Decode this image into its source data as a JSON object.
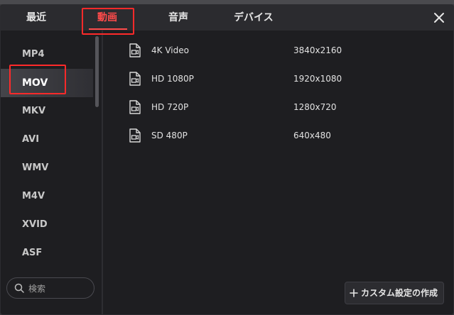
{
  "tabs": [
    {
      "label": "最近",
      "active": false
    },
    {
      "label": "動画",
      "active": true
    },
    {
      "label": "音声",
      "active": false
    },
    {
      "label": "デバイス",
      "active": false
    }
  ],
  "formats": [
    "MP4",
    "MOV",
    "MKV",
    "AVI",
    "WMV",
    "M4V",
    "XVID",
    "ASF"
  ],
  "selected_format": "MOV",
  "presets": [
    {
      "name": "4K Video",
      "resolution": "3840x2160"
    },
    {
      "name": "HD 1080P",
      "resolution": "1920x1080"
    },
    {
      "name": "HD 720P",
      "resolution": "1280x720"
    },
    {
      "name": "SD 480P",
      "resolution": "640x480"
    }
  ],
  "search": {
    "placeholder": "検索"
  },
  "custom_button": {
    "label": "カスタム設定の作成"
  },
  "colors": {
    "accent": "#ff4b4b",
    "background": "#1e1e21",
    "tabbar": "#2b2b2f"
  }
}
